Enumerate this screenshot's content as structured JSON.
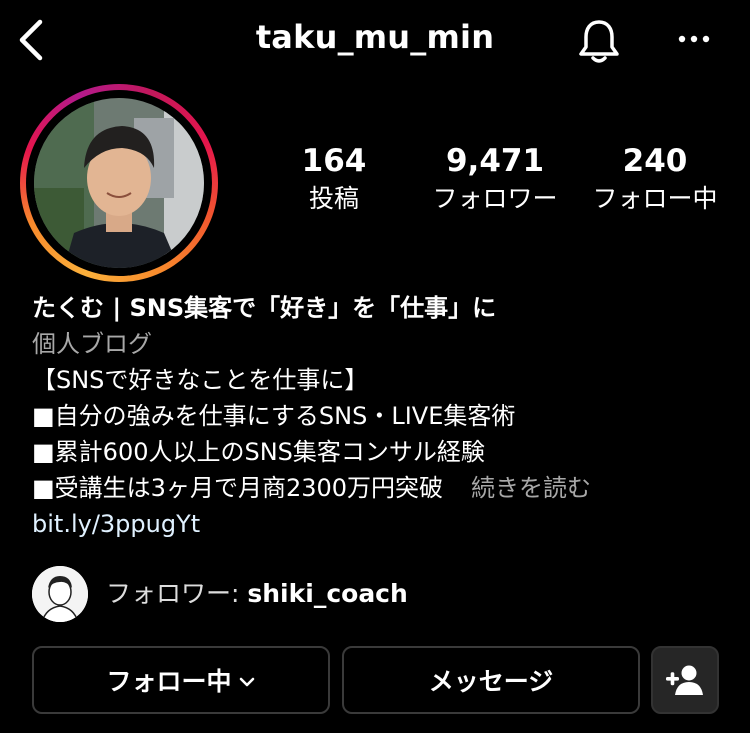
{
  "header": {
    "username": "taku_mu_min",
    "back_icon": "chevron-left-icon",
    "bell_icon": "bell-icon",
    "more_icon": "more-horizontal-icon"
  },
  "stats": [
    {
      "value": "164",
      "label": "投稿"
    },
    {
      "value": "9,471",
      "label": "フォロワー"
    },
    {
      "value": "240",
      "label": "フォロー中"
    }
  ],
  "bio": {
    "name": "たくむ | SNS集客で「好き」を「仕事」に",
    "category": "個人ブログ",
    "lines": [
      "【SNSで好きなことを仕事に】",
      "■自分の強みを仕事にするSNS・LIVE集客術",
      "■累計600人以上のSNS集客コンサル経験",
      "■受講生は3ヶ月で月商2300万円突破"
    ],
    "more": "続きを読む",
    "link": "bit.ly/3ppugYt"
  },
  "followed_by": {
    "prefix": "フォロワー: ",
    "username": "shiki_coach"
  },
  "actions": {
    "following_label": "フォロー中",
    "message_label": "メッセージ",
    "add_user_icon": "add-user-icon"
  },
  "colors": {
    "background": "#000000",
    "button_border": "#3a3a3a",
    "secondary_text": "#a8a8a8",
    "link": "#e0f1ff",
    "story_ring": [
      "#c2185b",
      "#e5154c",
      "#f88a2c",
      "#fbb03b"
    ]
  }
}
